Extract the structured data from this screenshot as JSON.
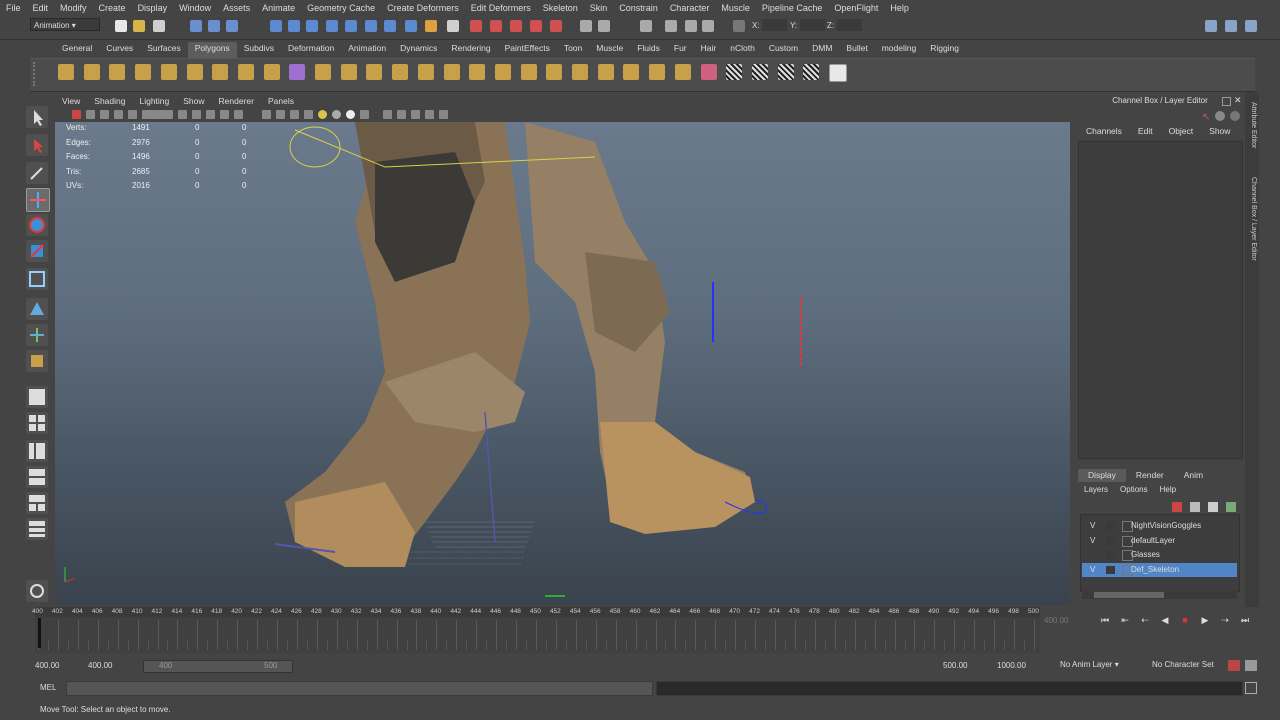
{
  "menus": [
    "File",
    "Edit",
    "Modify",
    "Create",
    "Display",
    "Window",
    "Assets",
    "Animate",
    "Geometry Cache",
    "Create Deformers",
    "Edit Deformers",
    "Skeleton",
    "Skin",
    "Constrain",
    "Character",
    "Muscle",
    "Pipeline Cache",
    "OpenFlight",
    "Help"
  ],
  "status_line": {
    "mode": "Animation",
    "x_label": "X:",
    "y_label": "Y:",
    "z_label": "Z:"
  },
  "shelf_tabs": [
    "General",
    "Curves",
    "Surfaces",
    "Polygons",
    "Subdivs",
    "Deformation",
    "Animation",
    "Dynamics",
    "Rendering",
    "PaintEffects",
    "Toon",
    "Muscle",
    "Fluids",
    "Fur",
    "Hair",
    "nCloth",
    "Custom",
    "DMM",
    "Bullet",
    "modeling",
    "Rigging"
  ],
  "active_shelf": "Polygons",
  "viewport": {
    "menu": [
      "View",
      "Shading",
      "Lighting",
      "Show",
      "Renderer",
      "Panels"
    ],
    "hud": [
      {
        "label": "Verts:",
        "v": "1491",
        "a": "0",
        "b": "0"
      },
      {
        "label": "Edges:",
        "v": "2976",
        "a": "0",
        "b": "0"
      },
      {
        "label": "Faces:",
        "v": "1496",
        "a": "0",
        "b": "0"
      },
      {
        "label": "Tris:",
        "v": "2685",
        "a": "0",
        "b": "0"
      },
      {
        "label": "UVs:",
        "v": "2016",
        "a": "0",
        "b": "0"
      }
    ]
  },
  "channel_box": {
    "title": "Channel Box / Layer Editor",
    "menu": [
      "Channels",
      "Edit",
      "Object",
      "Show"
    ],
    "side_tabs": [
      "Attribute Editor",
      "Channel Box / Layer Editor"
    ]
  },
  "layer_editor": {
    "tabs": [
      "Display",
      "Render",
      "Anim"
    ],
    "active_tab": "Display",
    "menu": [
      "Layers",
      "Options",
      "Help"
    ],
    "layers": [
      {
        "v": "V",
        "name": "NightVisionGoggles",
        "selected": false
      },
      {
        "v": "V",
        "name": "defaultLayer",
        "selected": false
      },
      {
        "v": "",
        "name": "Glasses",
        "selected": false
      },
      {
        "v": "V",
        "name": "Def_Skeleton",
        "selected": true
      }
    ]
  },
  "timeline": {
    "ticks": [
      "400",
      "402",
      "404",
      "406",
      "408",
      "410",
      "412",
      "414",
      "416",
      "418",
      "420",
      "422",
      "424",
      "426",
      "428",
      "430",
      "432",
      "434",
      "436",
      "438",
      "440",
      "442",
      "444",
      "446",
      "448",
      "450",
      "452",
      "454",
      "456",
      "458",
      "460",
      "462",
      "464",
      "466",
      "468",
      "470",
      "472",
      "474",
      "476",
      "478",
      "480",
      "482",
      "484",
      "486",
      "488",
      "490",
      "492",
      "494",
      "496",
      "498",
      "500"
    ],
    "current_frame": "400.00",
    "range_start": "400.00",
    "playback_start": "400.00",
    "slider_start": "400",
    "slider_end": "500",
    "playback_end": "500.00",
    "range_end": "1000.00",
    "anim_layer": "No Anim Layer",
    "character_set": "No Character Set"
  },
  "command_line": {
    "label": "MEL"
  },
  "help_line": "Move Tool: Select an object to move."
}
